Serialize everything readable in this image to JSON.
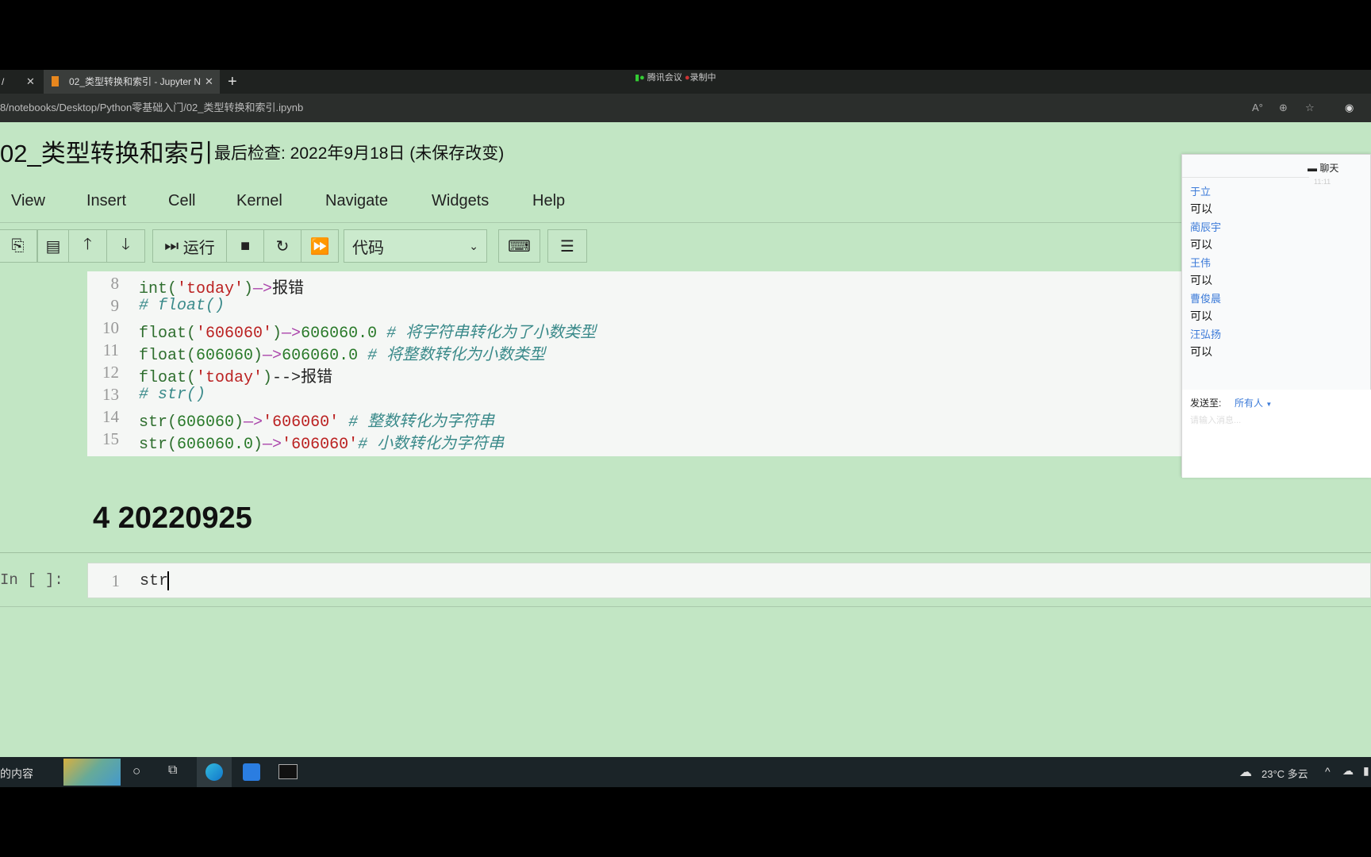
{
  "browser": {
    "tabs": [
      {
        "label": "/"
      },
      {
        "label": "02_类型转换和索引 - Jupyter N"
      }
    ],
    "new_tab": "+",
    "meeting": {
      "app": "腾讯会议",
      "status": "录制中"
    },
    "url": "8/notebooks/Desktop/Python零基础入门/02_类型转换和索引.ipynb",
    "icons": [
      "read-aloud-icon",
      "zoom-icon",
      "favorites-icon",
      "profile-icon"
    ]
  },
  "notebook": {
    "title": "02_类型转换和索引",
    "checkpoint": "最后检查: 2022年9月18日   (未保存改变)",
    "menu": [
      "View",
      "Insert",
      "Cell",
      "Kernel",
      "Navigate",
      "Widgets",
      "Help"
    ],
    "toolbar": {
      "run_label": "运行",
      "cell_type": "代码"
    },
    "code_lines": [
      {
        "n": "8",
        "tokens": [
          {
            "t": "int(",
            "c": "k"
          },
          {
            "t": "'today'",
            "c": "s"
          },
          {
            "t": ")",
            "c": "k"
          },
          {
            "t": "—>",
            "c": "o"
          },
          {
            "t": "报错",
            "c": "z"
          }
        ]
      },
      {
        "n": "9",
        "tokens": [
          {
            "t": "# float()",
            "c": "c"
          }
        ]
      },
      {
        "n": "10",
        "tokens": [
          {
            "t": "float(",
            "c": "k"
          },
          {
            "t": "'606060'",
            "c": "s"
          },
          {
            "t": ")",
            "c": "k"
          },
          {
            "t": "—>",
            "c": "o"
          },
          {
            "t": "606060.0 ",
            "c": "n"
          },
          {
            "t": "# 将字符串转化为了小数类型",
            "c": "c"
          }
        ]
      },
      {
        "n": "11",
        "tokens": [
          {
            "t": "float(",
            "c": "k"
          },
          {
            "t": "606060",
            "c": "n"
          },
          {
            "t": ")",
            "c": "k"
          },
          {
            "t": "—>",
            "c": "o"
          },
          {
            "t": "606060.0 ",
            "c": "n"
          },
          {
            "t": "# 将整数转化为小数类型",
            "c": "c"
          }
        ]
      },
      {
        "n": "12",
        "tokens": [
          {
            "t": "float(",
            "c": "k"
          },
          {
            "t": "'today'",
            "c": "s"
          },
          {
            "t": ")",
            "c": "k"
          },
          {
            "t": "-->",
            "c": "z"
          },
          {
            "t": "报错",
            "c": "z"
          }
        ]
      },
      {
        "n": "13",
        "tokens": [
          {
            "t": "# str()",
            "c": "c"
          }
        ]
      },
      {
        "n": "14",
        "tokens": [
          {
            "t": "str(",
            "c": "k"
          },
          {
            "t": "606060",
            "c": "n"
          },
          {
            "t": ")",
            "c": "k"
          },
          {
            "t": "—>",
            "c": "o"
          },
          {
            "t": "'606060' ",
            "c": "s"
          },
          {
            "t": "# 整数转化为字符串",
            "c": "c"
          }
        ]
      },
      {
        "n": "15",
        "tokens": [
          {
            "t": "str(",
            "c": "k"
          },
          {
            "t": "606060.0",
            "c": "n"
          },
          {
            "t": ")",
            "c": "k"
          },
          {
            "t": "—>",
            "c": "o"
          },
          {
            "t": "'606060'",
            "c": "s"
          },
          {
            "t": "# 小数转化为字符串",
            "c": "c"
          }
        ]
      }
    ],
    "heading": "4  20220925",
    "input_cell": {
      "prompt": "In  [  ]:",
      "line": "1",
      "code": "str"
    }
  },
  "chat": {
    "title": "聊天",
    "time": "11:11",
    "messages": [
      {
        "name": "于立",
        "text": "可以"
      },
      {
        "name": "蔺辰宇",
        "text": "可以"
      },
      {
        "name": "王伟",
        "text": "可以"
      },
      {
        "name": "曹俊晨",
        "text": "可以"
      },
      {
        "name": "汪弘扬",
        "text": "可以"
      }
    ],
    "send_to_label": "发送至:",
    "send_to_value": "所有人",
    "placeholder": "请输入消息..."
  },
  "taskbar": {
    "search_text": "的内容",
    "weather": "23°C 多云"
  }
}
